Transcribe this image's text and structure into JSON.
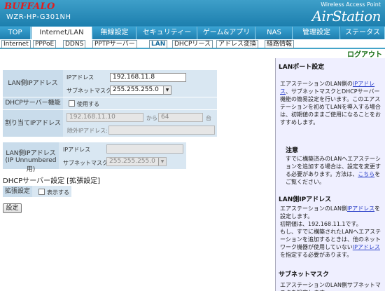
{
  "header": {
    "logo": "BUFFALO",
    "model": "WZR-HP-G301NH",
    "brand_sub": "Wireless Access Point",
    "brand_main": "AirStation"
  },
  "tabs": [
    "TOP",
    "Internet/LAN",
    "無線設定",
    "セキュリティー",
    "ゲーム&アプリ",
    "NAS",
    "管理設定",
    "ステータス"
  ],
  "subtabs": [
    "Internet",
    "PPPoE",
    "DDNS",
    "PPTPサーバー",
    "LAN",
    "DHCPリース",
    "アドレス変換",
    "経路情報"
  ],
  "logout": "ログアウト",
  "form": {
    "lan_ip": {
      "label": "LAN側IPアドレス",
      "ip_label": "IPアドレス",
      "ip_value": "192.168.11.8",
      "mask_label": "サブネットマスク",
      "mask_value": "255.255.255.0"
    },
    "dhcp": {
      "label": "DHCPサーバー機能",
      "use_label": "使用する"
    },
    "assign": {
      "label": "割り当てIPアドレス",
      "start": "192.168.11.10",
      "from": "から",
      "count": "64",
      "unit": "台",
      "exclude_label": "除外IPアドレス:"
    },
    "unnumbered": {
      "label1": "LAN側IPアドレス",
      "label2": "(IP Unnumbered用)",
      "ip_label": "IPアドレス",
      "mask_label": "サブネットマスク",
      "mask_value": "255.255.255.0"
    },
    "section_title": "DHCPサーバー設定 [拡張設定]",
    "ext": {
      "label": "拡張設定",
      "show_label": "表示する"
    },
    "submit": "設定"
  },
  "help": {
    "h1": "LANポート設定",
    "p1a": "エアステーションのLAN側の",
    "p1link": "IPアドレス",
    "p1b": "、サブネットマスクとDHCPサーバー機能の簡易設定を行います。",
    "p1c": "このエアステーションを初めてLANを導入する場合は、初期値のままご使用になることをおすすめします。",
    "note_h": "注意",
    "note_a": "すでに構築済みのLANへエアステーションを追加する場合は、設定を変更する必要があります。方法は、",
    "note_link": "こちら",
    "note_b": "をご覧ください。",
    "h2": "LAN側IPアドレス",
    "p2a": "エアステーションのLAN側",
    "p2link": "IPアドレス",
    "p2b": "を設定します。",
    "p2c": "初期値は、192.168.11.1です。",
    "p2d": "もし、すでに構築されたLANへエアステーションを追加するときは、他のネットワーク機器が使用していない",
    "p2link2": "IPアドレス",
    "p2e": "を指定する必要があります。",
    "h3": "サブネットマスク",
    "p3": "エアステーションのLAN側サブネットマスクを設定します。"
  }
}
